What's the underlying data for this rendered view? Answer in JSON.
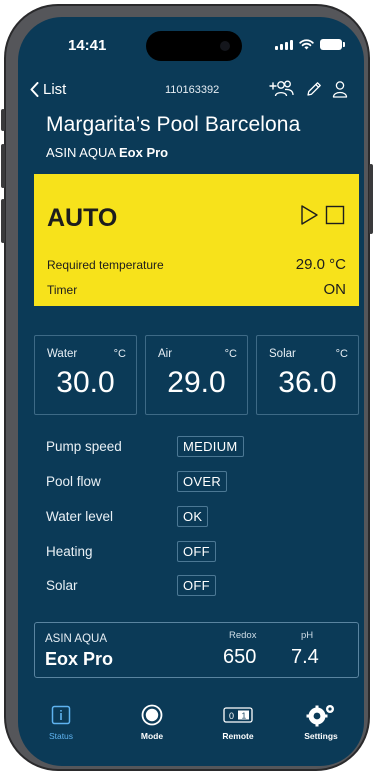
{
  "status_bar": {
    "time": "14:41"
  },
  "nav": {
    "back_label": "List",
    "device_id": "110163392"
  },
  "header": {
    "pool_name": "Margarita’s Pool Barcelona",
    "brand": "ASIN AQUA",
    "model": "Eox Pro"
  },
  "mode_panel": {
    "mode": "AUTO",
    "background_color": "#f7e21b",
    "required_temperature_label": "Required temperature",
    "required_temperature_value": "29.0 °C",
    "timer_label": "Timer",
    "timer_value": "ON"
  },
  "temperatures": [
    {
      "label": "Water",
      "unit": "°C",
      "value": "30.0"
    },
    {
      "label": "Air",
      "unit": "°C",
      "value": "29.0"
    },
    {
      "label": "Solar",
      "unit": "°C",
      "value": "36.0"
    }
  ],
  "status_rows": [
    {
      "label": "Pump speed",
      "value": "MEDIUM"
    },
    {
      "label": "Pool flow",
      "value": "OVER"
    },
    {
      "label": "Water level",
      "value": "OK"
    },
    {
      "label": "Heating",
      "value": "OFF"
    },
    {
      "label": "Solar",
      "value": "OFF"
    }
  ],
  "device_card": {
    "brand": "ASIN AQUA",
    "model": "Eox Pro",
    "redox_label": "Redox",
    "redox_value": "650",
    "ph_label": "pH",
    "ph_value": "7.4"
  },
  "tabs": [
    {
      "label": "Status",
      "icon": "info-icon",
      "active": true
    },
    {
      "label": "Mode",
      "icon": "mode-circle-icon",
      "active": false
    },
    {
      "label": "Remote",
      "icon": "remote-switch-icon",
      "active": false
    },
    {
      "label": "Settings",
      "icon": "gear-icon",
      "active": false
    }
  ],
  "colors": {
    "background": "#0b3a57",
    "accent": "#5fb3f0",
    "mode_yellow": "#f7e21b"
  }
}
